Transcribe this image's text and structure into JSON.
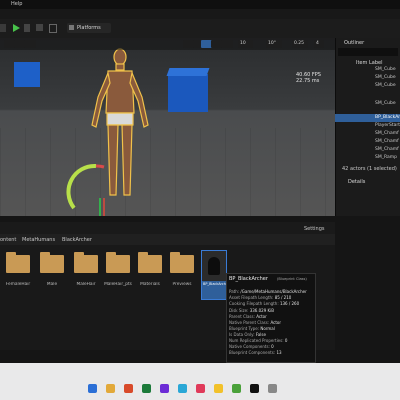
{
  "menu": {
    "item": "Help"
  },
  "toolbar": {
    "platforms": "Platforms"
  },
  "viewport": {
    "fps": "40.60 FPS",
    "ms": "22.75 ms",
    "grid_value": "10",
    "rot_value": "10°",
    "scale_value": "0.25",
    "cam_value": "4"
  },
  "outliner": {
    "title": "Outliner",
    "header": "Item Label",
    "items": [
      "SM_Cube",
      "SM_Cube",
      "SM_Cube",
      "SM_Cube",
      "BP_BlackAr",
      "PlayerStart",
      "SM_Chamf",
      "SM_Chamf",
      "SM_Chamf",
      "SM_Ramp"
    ],
    "count": "42 actors (1 selected)",
    "details": "Details"
  },
  "content_browser": {
    "path_items": [
      "ontent",
      "MetaHumans",
      "BlackArcher"
    ],
    "settings": "Settings",
    "folders": [
      "FemaleHair",
      "Male",
      "MaleHair",
      "MaleHair_pts",
      "Materials",
      "Previews"
    ],
    "asset_label": "BP_BlackArcher"
  },
  "tooltip": {
    "title": "BP_BlackArcher",
    "subtitle": "(Blueprint Class)",
    "rows": [
      {
        "k": "Path:",
        "v": "/Game/MetaHumans/BlackArcher"
      },
      {
        "k": "Asset Filepath Length:",
        "v": "85 / 210"
      },
      {
        "k": "Cooking Filepath Length:",
        "v": "136 / 260"
      },
      {
        "k": "Disk Size:",
        "v": "336.029 KiB"
      },
      {
        "k": "Parent Class:",
        "v": "Actor"
      },
      {
        "k": "Native Parent Class:",
        "v": "Actor"
      },
      {
        "k": "Blueprint Type:",
        "v": "Normal"
      },
      {
        "k": "Is Data Only:",
        "v": "False"
      },
      {
        "k": "Num Replicated Properties:",
        "v": "0"
      },
      {
        "k": "Native Components:",
        "v": "0"
      },
      {
        "k": "Blueprint Components:",
        "v": "13"
      }
    ]
  },
  "watermark": "ademy",
  "colors": {
    "accent": "#3a7bd5",
    "selection": "#2f5f9a",
    "folder": "#c99a55",
    "cube": "#1e60c8"
  },
  "icons": [
    "play-icon",
    "pause-icon",
    "stop-icon",
    "folder-icon",
    "settings-icon"
  ]
}
